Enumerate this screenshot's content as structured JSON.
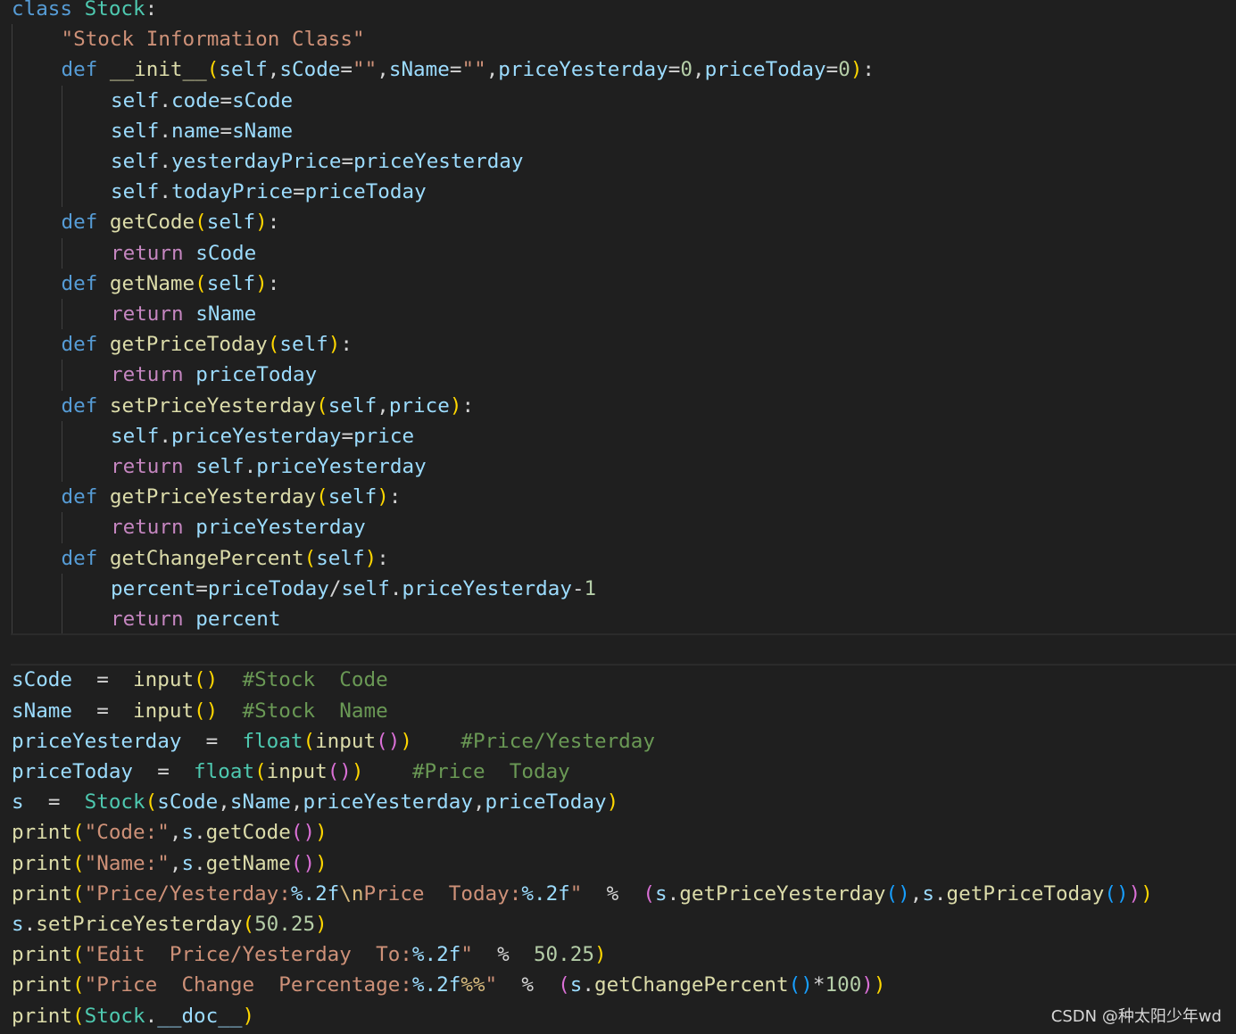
{
  "lines": [
    {
      "indent": 0,
      "tokens": [
        [
          "kw",
          "class"
        ],
        [
          "op",
          " "
        ],
        [
          "cls",
          "Stock"
        ],
        [
          "op",
          ":"
        ]
      ]
    },
    {
      "indent": 1,
      "tokens": [
        [
          "str",
          "\"Stock Information Class\""
        ]
      ]
    },
    {
      "indent": 1,
      "tokens": [
        [
          "kw",
          "def"
        ],
        [
          "op",
          " "
        ],
        [
          "fn",
          "__init__"
        ],
        [
          "b1",
          "("
        ],
        [
          "var",
          "self"
        ],
        [
          "op",
          ","
        ],
        [
          "var",
          "sCode"
        ],
        [
          "op",
          "="
        ],
        [
          "str",
          "\"\""
        ],
        [
          "op",
          ","
        ],
        [
          "var",
          "sName"
        ],
        [
          "op",
          "="
        ],
        [
          "str",
          "\"\""
        ],
        [
          "op",
          ","
        ],
        [
          "var",
          "priceYesterday"
        ],
        [
          "op",
          "="
        ],
        [
          "num",
          "0"
        ],
        [
          "op",
          ","
        ],
        [
          "var",
          "priceToday"
        ],
        [
          "op",
          "="
        ],
        [
          "num",
          "0"
        ],
        [
          "b1",
          ")"
        ],
        [
          "op",
          ":"
        ]
      ]
    },
    {
      "indent": 2,
      "tokens": [
        [
          "var",
          "self"
        ],
        [
          "op",
          "."
        ],
        [
          "var",
          "code"
        ],
        [
          "op",
          "="
        ],
        [
          "var",
          "sCode"
        ]
      ]
    },
    {
      "indent": 2,
      "tokens": [
        [
          "var",
          "self"
        ],
        [
          "op",
          "."
        ],
        [
          "var",
          "name"
        ],
        [
          "op",
          "="
        ],
        [
          "var",
          "sName"
        ]
      ]
    },
    {
      "indent": 2,
      "tokens": [
        [
          "var",
          "self"
        ],
        [
          "op",
          "."
        ],
        [
          "var",
          "yesterdayPrice"
        ],
        [
          "op",
          "="
        ],
        [
          "var",
          "priceYesterday"
        ]
      ]
    },
    {
      "indent": 2,
      "tokens": [
        [
          "var",
          "self"
        ],
        [
          "op",
          "."
        ],
        [
          "var",
          "todayPrice"
        ],
        [
          "op",
          "="
        ],
        [
          "var",
          "priceToday"
        ]
      ]
    },
    {
      "indent": 1,
      "tokens": [
        [
          "kw",
          "def"
        ],
        [
          "op",
          " "
        ],
        [
          "fn",
          "getCode"
        ],
        [
          "b1",
          "("
        ],
        [
          "var",
          "self"
        ],
        [
          "b1",
          ")"
        ],
        [
          "op",
          ":"
        ]
      ]
    },
    {
      "indent": 2,
      "tokens": [
        [
          "ret",
          "return"
        ],
        [
          "op",
          " "
        ],
        [
          "var",
          "sCode"
        ]
      ]
    },
    {
      "indent": 1,
      "tokens": [
        [
          "kw",
          "def"
        ],
        [
          "op",
          " "
        ],
        [
          "fn",
          "getName"
        ],
        [
          "b1",
          "("
        ],
        [
          "var",
          "self"
        ],
        [
          "b1",
          ")"
        ],
        [
          "op",
          ":"
        ]
      ]
    },
    {
      "indent": 2,
      "tokens": [
        [
          "ret",
          "return"
        ],
        [
          "op",
          " "
        ],
        [
          "var",
          "sName"
        ]
      ]
    },
    {
      "indent": 1,
      "tokens": [
        [
          "kw",
          "def"
        ],
        [
          "op",
          " "
        ],
        [
          "fn",
          "getPriceToday"
        ],
        [
          "b1",
          "("
        ],
        [
          "var",
          "self"
        ],
        [
          "b1",
          ")"
        ],
        [
          "op",
          ":"
        ]
      ]
    },
    {
      "indent": 2,
      "tokens": [
        [
          "ret",
          "return"
        ],
        [
          "op",
          " "
        ],
        [
          "var",
          "priceToday"
        ]
      ]
    },
    {
      "indent": 1,
      "tokens": [
        [
          "kw",
          "def"
        ],
        [
          "op",
          " "
        ],
        [
          "fn",
          "setPriceYesterday"
        ],
        [
          "b1",
          "("
        ],
        [
          "var",
          "self"
        ],
        [
          "op",
          ","
        ],
        [
          "var",
          "price"
        ],
        [
          "b1",
          ")"
        ],
        [
          "op",
          ":"
        ]
      ]
    },
    {
      "indent": 2,
      "tokens": [
        [
          "var",
          "self"
        ],
        [
          "op",
          "."
        ],
        [
          "var",
          "priceYesterday"
        ],
        [
          "op",
          "="
        ],
        [
          "var",
          "price"
        ]
      ]
    },
    {
      "indent": 2,
      "tokens": [
        [
          "ret",
          "return"
        ],
        [
          "op",
          " "
        ],
        [
          "var",
          "self"
        ],
        [
          "op",
          "."
        ],
        [
          "var",
          "priceYesterday"
        ]
      ]
    },
    {
      "indent": 1,
      "tokens": [
        [
          "kw",
          "def"
        ],
        [
          "op",
          " "
        ],
        [
          "fn",
          "getPriceYesterday"
        ],
        [
          "b1",
          "("
        ],
        [
          "var",
          "self"
        ],
        [
          "b1",
          ")"
        ],
        [
          "op",
          ":"
        ]
      ]
    },
    {
      "indent": 2,
      "tokens": [
        [
          "ret",
          "return"
        ],
        [
          "op",
          " "
        ],
        [
          "var",
          "priceYesterday"
        ]
      ]
    },
    {
      "indent": 1,
      "tokens": [
        [
          "kw",
          "def"
        ],
        [
          "op",
          " "
        ],
        [
          "fn",
          "getChangePercent"
        ],
        [
          "b1",
          "("
        ],
        [
          "var",
          "self"
        ],
        [
          "b1",
          ")"
        ],
        [
          "op",
          ":"
        ]
      ]
    },
    {
      "indent": 2,
      "tokens": [
        [
          "var",
          "percent"
        ],
        [
          "op",
          "="
        ],
        [
          "var",
          "priceToday"
        ],
        [
          "op",
          "/"
        ],
        [
          "var",
          "self"
        ],
        [
          "op",
          "."
        ],
        [
          "var",
          "priceYesterday"
        ],
        [
          "op",
          "-"
        ],
        [
          "num",
          "1"
        ]
      ]
    },
    {
      "indent": 2,
      "tokens": [
        [
          "ret",
          "return"
        ],
        [
          "op",
          " "
        ],
        [
          "var",
          "percent"
        ]
      ]
    },
    {
      "indent": 0,
      "tokens": []
    },
    {
      "indent": 0,
      "tokens": [
        [
          "var",
          "sCode"
        ],
        [
          "op",
          "  =  "
        ],
        [
          "fn",
          "input"
        ],
        [
          "b1",
          "()"
        ],
        [
          "op",
          "  "
        ],
        [
          "cmt",
          "#Stock  Code"
        ]
      ]
    },
    {
      "indent": 0,
      "tokens": [
        [
          "var",
          "sName"
        ],
        [
          "op",
          "  =  "
        ],
        [
          "fn",
          "input"
        ],
        [
          "b1",
          "()"
        ],
        [
          "op",
          "  "
        ],
        [
          "cmt",
          "#Stock  Name"
        ]
      ]
    },
    {
      "indent": 0,
      "tokens": [
        [
          "var",
          "priceYesterday"
        ],
        [
          "op",
          "  =  "
        ],
        [
          "cls",
          "float"
        ],
        [
          "b1",
          "("
        ],
        [
          "fn",
          "input"
        ],
        [
          "b2",
          "()"
        ],
        [
          "b1",
          ")"
        ],
        [
          "op",
          "    "
        ],
        [
          "cmt",
          "#Price/Yesterday"
        ]
      ]
    },
    {
      "indent": 0,
      "tokens": [
        [
          "var",
          "priceToday"
        ],
        [
          "op",
          "  =  "
        ],
        [
          "cls",
          "float"
        ],
        [
          "b1",
          "("
        ],
        [
          "fn",
          "input"
        ],
        [
          "b2",
          "()"
        ],
        [
          "b1",
          ")"
        ],
        [
          "op",
          "    "
        ],
        [
          "cmt",
          "#Price  Today"
        ]
      ]
    },
    {
      "indent": 0,
      "tokens": [
        [
          "var",
          "s"
        ],
        [
          "op",
          "  =  "
        ],
        [
          "cls",
          "Stock"
        ],
        [
          "b1",
          "("
        ],
        [
          "var",
          "sCode"
        ],
        [
          "op",
          ","
        ],
        [
          "var",
          "sName"
        ],
        [
          "op",
          ","
        ],
        [
          "var",
          "priceYesterday"
        ],
        [
          "op",
          ","
        ],
        [
          "var",
          "priceToday"
        ],
        [
          "b1",
          ")"
        ]
      ]
    },
    {
      "indent": 0,
      "tokens": [
        [
          "fn",
          "print"
        ],
        [
          "b1",
          "("
        ],
        [
          "str",
          "\"Code:\""
        ],
        [
          "op",
          ","
        ],
        [
          "var",
          "s"
        ],
        [
          "op",
          "."
        ],
        [
          "fn",
          "getCode"
        ],
        [
          "b2",
          "()"
        ],
        [
          "b1",
          ")"
        ]
      ]
    },
    {
      "indent": 0,
      "tokens": [
        [
          "fn",
          "print"
        ],
        [
          "b1",
          "("
        ],
        [
          "str",
          "\"Name:\""
        ],
        [
          "op",
          ","
        ],
        [
          "var",
          "s"
        ],
        [
          "op",
          "."
        ],
        [
          "fn",
          "getName"
        ],
        [
          "b2",
          "()"
        ],
        [
          "b1",
          ")"
        ]
      ]
    },
    {
      "indent": 0,
      "tokens": [
        [
          "fn",
          "print"
        ],
        [
          "b1",
          "("
        ],
        [
          "str",
          "\"Price/Yesterday:"
        ],
        [
          "var",
          "%.2f"
        ],
        [
          "esc",
          "\\n"
        ],
        [
          "str",
          "Price  Today:"
        ],
        [
          "var",
          "%.2f"
        ],
        [
          "str",
          "\""
        ],
        [
          "op",
          "  %  "
        ],
        [
          "b2",
          "("
        ],
        [
          "var",
          "s"
        ],
        [
          "op",
          "."
        ],
        [
          "fn",
          "getPriceYesterday"
        ],
        [
          "b3",
          "()"
        ],
        [
          "op",
          ","
        ],
        [
          "var",
          "s"
        ],
        [
          "op",
          "."
        ],
        [
          "fn",
          "getPriceToday"
        ],
        [
          "b3",
          "()"
        ],
        [
          "b2",
          ")"
        ],
        [
          "b1",
          ")"
        ]
      ]
    },
    {
      "indent": 0,
      "tokens": [
        [
          "var",
          "s"
        ],
        [
          "op",
          "."
        ],
        [
          "fn",
          "setPriceYesterday"
        ],
        [
          "b1",
          "("
        ],
        [
          "num",
          "50.25"
        ],
        [
          "b1",
          ")"
        ]
      ]
    },
    {
      "indent": 0,
      "tokens": [
        [
          "fn",
          "print"
        ],
        [
          "b1",
          "("
        ],
        [
          "str",
          "\"Edit  Price/Yesterday  To:"
        ],
        [
          "var",
          "%.2f"
        ],
        [
          "str",
          "\""
        ],
        [
          "op",
          "  %  "
        ],
        [
          "num",
          "50.25"
        ],
        [
          "b1",
          ")"
        ]
      ]
    },
    {
      "indent": 0,
      "tokens": [
        [
          "fn",
          "print"
        ],
        [
          "b1",
          "("
        ],
        [
          "str",
          "\"Price  Change  Percentage:"
        ],
        [
          "var",
          "%.2f"
        ],
        [
          "esc",
          "%%"
        ],
        [
          "str",
          "\""
        ],
        [
          "op",
          "  %  "
        ],
        [
          "b2",
          "("
        ],
        [
          "var",
          "s"
        ],
        [
          "op",
          "."
        ],
        [
          "fn",
          "getChangePercent"
        ],
        [
          "b3",
          "()"
        ],
        [
          "op",
          "*"
        ],
        [
          "num",
          "100"
        ],
        [
          "b2",
          ")"
        ],
        [
          "b1",
          ")"
        ]
      ]
    },
    {
      "indent": 0,
      "tokens": [
        [
          "fn",
          "print"
        ],
        [
          "b1",
          "("
        ],
        [
          "cls",
          "Stock"
        ],
        [
          "op",
          "."
        ],
        [
          "var",
          "__doc__"
        ],
        [
          "b1",
          ")"
        ]
      ]
    }
  ],
  "watermark": "CSDN @种太阳少年wd"
}
